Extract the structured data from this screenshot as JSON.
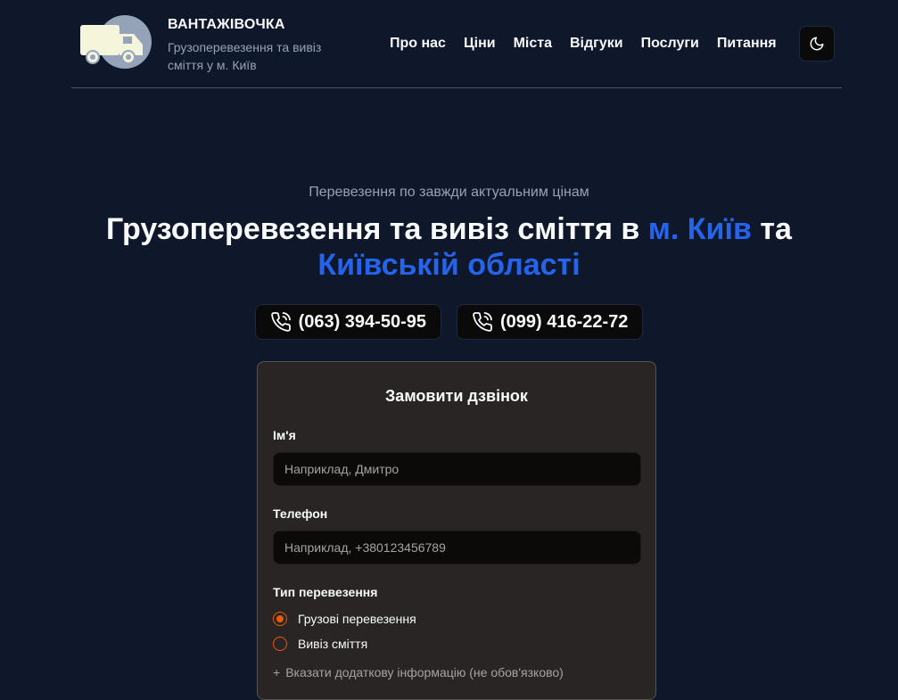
{
  "header": {
    "brand_title": "ВАНТАЖІВОЧКА",
    "brand_subtitle": "Грузоперевезення та вивіз сміття у м. Київ",
    "nav": [
      "Про нас",
      "Ціни",
      "Міста",
      "Відгуки",
      "Послуги",
      "Питання"
    ],
    "theme_icon": "moon-icon"
  },
  "hero": {
    "pretitle": "Перевезення по завжди актуальним цінам",
    "title_part1": "Грузоперевезення та вивіз сміття в ",
    "title_hl1": "м. Київ",
    "title_part2": " та ",
    "title_hl2": "Київській області",
    "accent_color": "#2563eb"
  },
  "phones": [
    "(063) 394-50-95",
    "(099) 416-22-72"
  ],
  "form": {
    "title": "Замовити дзвінок",
    "name_label": "Ім'я",
    "name_placeholder": "Наприклад, Дмитро",
    "phone_label": "Телефон",
    "phone_placeholder": "Наприклад, +380123456789",
    "type_label": "Тип перевезення",
    "options": [
      "Грузові перевезення",
      "Вивіз сміття"
    ],
    "selected_option": "Грузові перевезення",
    "more_info": "Вказати додаткову інформацію (не обов'язково)",
    "radio_color": "#ea580c"
  }
}
